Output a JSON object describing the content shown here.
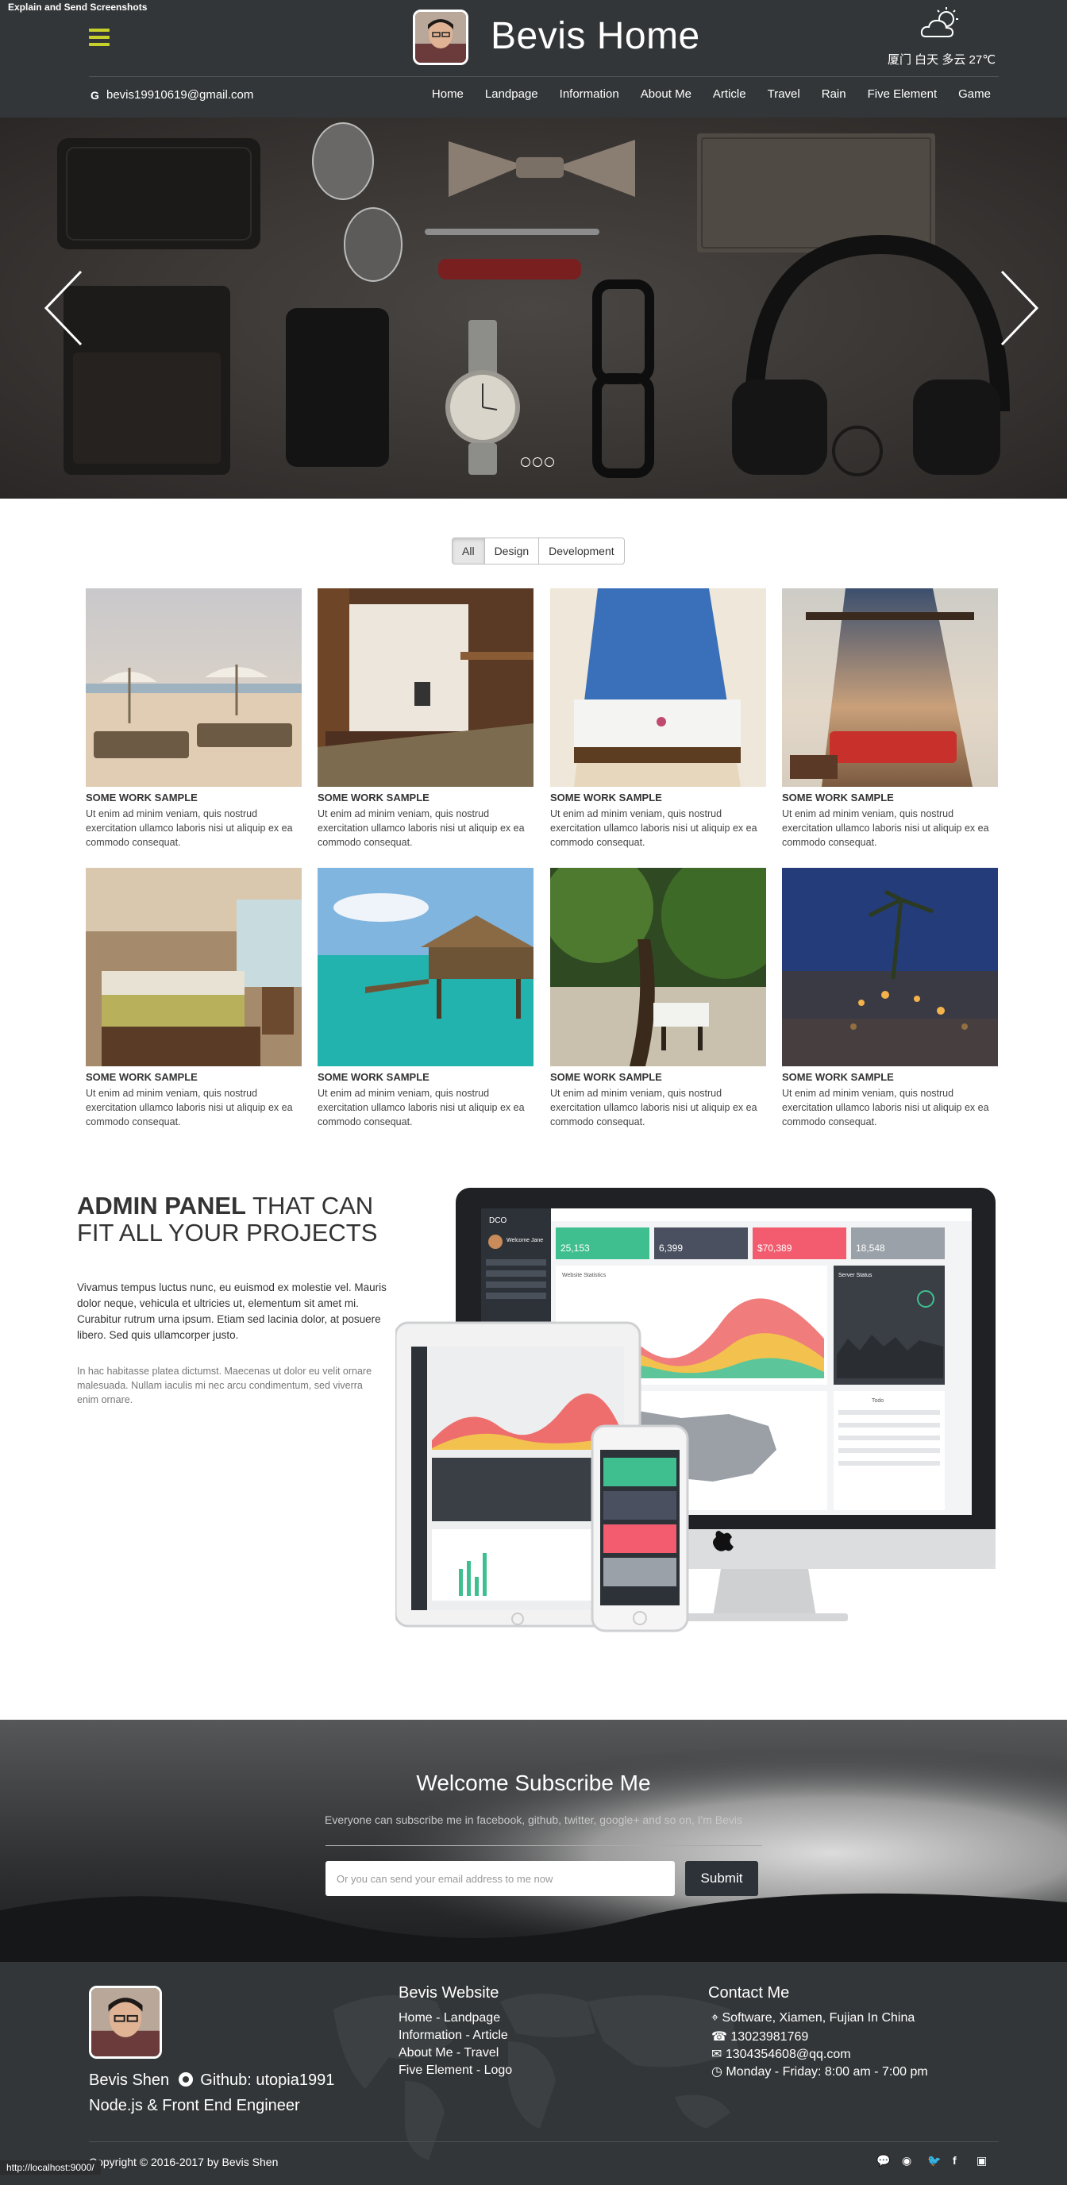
{
  "overlay": {
    "top_note": "Explain and Send Screenshots",
    "status_url": "http://localhost:9000/"
  },
  "header": {
    "brand": "Bevis Home",
    "weather": "厦门 白天 多云 27℃",
    "email": "bevis19910619@gmail.com",
    "nav": [
      "Home",
      "Landpage",
      "Information",
      "About Me",
      "Article",
      "Travel",
      "Rain",
      "Five Element",
      "Game"
    ]
  },
  "hero": {
    "slides": 3,
    "active_slide": 1
  },
  "portfolio": {
    "filters": [
      "All",
      "Design",
      "Development"
    ],
    "active_filter": "All",
    "items": [
      {
        "title": "SOME WORK SAMPLE",
        "desc": "Ut enim ad minim veniam, quis nostrud exercitation ullamco laboris nisi ut aliquip ex ea commodo consequat."
      },
      {
        "title": "SOME WORK SAMPLE",
        "desc": "Ut enim ad minim veniam, quis nostrud exercitation ullamco laboris nisi ut aliquip ex ea commodo consequat."
      },
      {
        "title": "SOME WORK SAMPLE",
        "desc": "Ut enim ad minim veniam, quis nostrud exercitation ullamco laboris nisi ut aliquip ex ea commodo consequat."
      },
      {
        "title": "SOME WORK SAMPLE",
        "desc": "Ut enim ad minim veniam, quis nostrud exercitation ullamco laboris nisi ut aliquip ex ea commodo consequat."
      },
      {
        "title": "SOME WORK SAMPLE",
        "desc": "Ut enim ad minim veniam, quis nostrud exercitation ullamco laboris nisi ut aliquip ex ea commodo consequat."
      },
      {
        "title": "SOME WORK SAMPLE",
        "desc": "Ut enim ad minim veniam, quis nostrud exercitation ullamco laboris nisi ut aliquip ex ea commodo consequat."
      },
      {
        "title": "SOME WORK SAMPLE",
        "desc": "Ut enim ad minim veniam, quis nostrud exercitation ullamco laboris nisi ut aliquip ex ea commodo consequat."
      },
      {
        "title": "SOME WORK SAMPLE",
        "desc": "Ut enim ad minim veniam, quis nostrud exercitation ullamco laboris nisi ut aliquip ex ea commodo consequat."
      }
    ]
  },
  "admin": {
    "title_bold": "ADMIN PANEL",
    "title_rest": " THAT CAN FIT ALL YOUR PROJECTS",
    "p1": "Vivamus tempus luctus nunc, eu euismod ex molestie vel. Mauris dolor neque, vehicula et ultricies ut, elementum sit amet mi. Curabitur rutrum urna ipsum. Etiam sed lacinia dolor, at posuere libero. Sed quis ullamcorper justo.",
    "p2": "In hac habitasse platea dictumst. Maecenas ut dolor eu velit ornare malesuada. Nullam iaculis mi nec arcu condimentum, sed viverra enim ornare.",
    "screen": {
      "logo": "DCO",
      "welcome": "Welcome Jane",
      "stats": [
        "25,153",
        "6,399",
        "$70,389",
        "18,548"
      ],
      "stat_colors": [
        "#3fbf8f",
        "#4a5060",
        "#f25c6e",
        "#9aa1a8"
      ],
      "panel_title": "Website Statistics",
      "server_title": "Server Status",
      "todo_title": "Todo"
    }
  },
  "subscribe": {
    "title": "Welcome Subscribe Me",
    "subtitle": "Everyone can subscribe me in facebook, github, twitter, google+ and so on, I'm Bevis",
    "placeholder": "Or you can send your email address to me now",
    "button": "Submit"
  },
  "footer": {
    "name": "Bevis Shen",
    "github": "Github: utopia1991",
    "role": "Node.js & Front End Engineer",
    "website_title": "Bevis Website",
    "links": [
      "Home - Landpage",
      "Information - Article",
      "About Me - Travel",
      "Five Element - Logo"
    ],
    "contact_title": "Contact Me",
    "address": "Software, Xiamen, Fujian In China",
    "phone": "13023981769",
    "mail": "1304354608@qq.com",
    "hours": "Monday - Friday: 8:00 am - 7:00 pm",
    "copyright": "Copyright © 2016-2017 by Bevis Shen",
    "social_icons": [
      "wechat-icon",
      "weibo-icon",
      "twitter-icon",
      "facebook-icon",
      "instagram-icon"
    ]
  }
}
